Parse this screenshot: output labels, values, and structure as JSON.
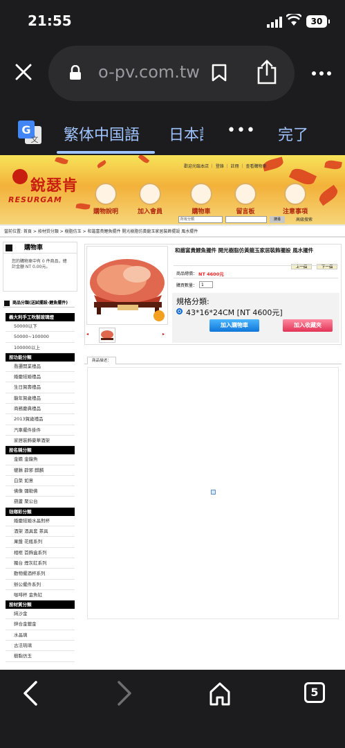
{
  "status_bar": {
    "time": "21:55",
    "battery": "30"
  },
  "browser": {
    "url": "o-pv.com.tw",
    "translate": {
      "lang1": "繁体中国語",
      "lang2": "日本語",
      "more": "•••",
      "done": "完了"
    },
    "tabs_count": "5"
  },
  "site": {
    "logo_cn": "銳瑟肯",
    "logo_en": "RESURGAM",
    "top_links": "歡迎光臨本店  ｜  登錄 ｜ 註冊 ｜ 查看購物車",
    "nav": [
      "購物說明",
      "加入會員",
      "購物車",
      "留言板",
      "注意事項"
    ],
    "search": {
      "category_placeholder": "所有分類",
      "button": "搜尋",
      "advanced": "高級搜索"
    },
    "breadcrumb": "當前位置: 首頁 > 按材質分類 > 樹脂仿玉 > 和諧富貴鯉魚擺件 開光樹脂仿黃龍玉家居裝飾擺設 風水擺件"
  },
  "cart": {
    "title": "購物車",
    "text_line1": "您的購物車中有 0 件商品，總",
    "text_line2": "計金額 NT 0.00元。"
  },
  "categories": {
    "heading": "商品分類(送試擺設-鯉魚擺件)",
    "sections": [
      {
        "title": "義大利手工吹製玻璃燈",
        "items": [
          "50000以下",
          "50000~100000",
          "100000以上"
        ]
      },
      {
        "title": "按功能分類",
        "items": [
          "喬遷開業禮品",
          "婚慶結婚禮品",
          "生日賀壽禮品",
          "龍年賀歲禮品",
          "商務慶典禮品",
          "2013賀歲禮品",
          "汽車擺件掛件",
          "家居裝飾豪華酒架"
        ]
      },
      {
        "title": "按名稱分類",
        "items": [
          "金蟾 金龍魚",
          "貔貅 辟邪 麒麟",
          "白菜 如意",
          "佛像 彌勒佛",
          "葫蘆 聚公台"
        ]
      },
      {
        "title": "琺瑯彩分類",
        "items": [
          "婚慶結婚水晶對杯",
          "酒架 酒具套 茶具",
          "果盤 花瓶系列",
          "相框 首飾盒系列",
          "獨台 煙灰缸系列",
          "動物擺酒杯系列",
          "辦公擺件系列",
          "咖啡杯 金魚缸"
        ]
      },
      {
        "title": "按材質分類",
        "items": [
          "純沙金",
          "鋅合金鍍金",
          "水晶璃",
          "古法琉璃",
          "樹脂仿玉"
        ]
      }
    ]
  },
  "product": {
    "title": "和諧富貴鯉魚擺件 開光樹脂仿黃龍玉家居裝飾擺設 風水擺件",
    "prev": "上一個",
    "next": "下一個",
    "price_label": "商品總價：",
    "price": "NT 4600元",
    "qty_label": "購買數量：",
    "qty": "1",
    "spec_title": "規格分類:",
    "spec_option": "43*16*24CM [NT 4600元]",
    "add_cart": "加入購物車",
    "add_fav": "加入收藏夾",
    "desc_tab": "商品描述："
  },
  "colors": {
    "accent_blue": "#0f76d8",
    "price_red": "#e22222",
    "brand_red": "#c81e10"
  }
}
